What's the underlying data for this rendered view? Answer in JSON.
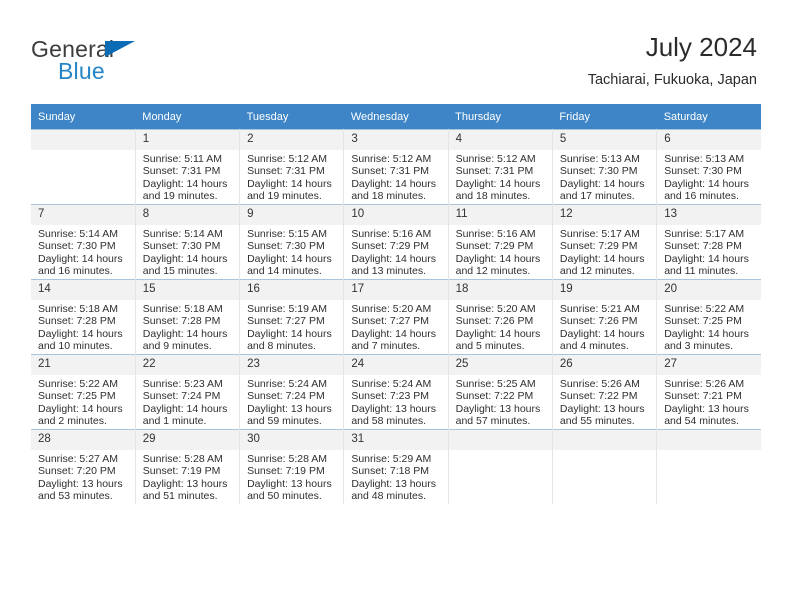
{
  "brand": {
    "name_part1": "General",
    "name_part2": "Blue",
    "triangle_color": "#0b6cb5",
    "blue_color": "#2585c7"
  },
  "header": {
    "title": "July 2024",
    "subtitle": "Tachiarai, Fukuoka, Japan"
  },
  "theme": {
    "header_row_bg": "#3d85c6",
    "header_row_text": "#ffffff",
    "daynum_bg": "#f2f2f2",
    "grid_line": "#a9c4dd"
  },
  "calendar": {
    "weekday_headers": [
      "Sunday",
      "Monday",
      "Tuesday",
      "Wednesday",
      "Thursday",
      "Friday",
      "Saturday"
    ],
    "weeks": [
      [
        {
          "day": "",
          "sunrise": "",
          "sunset": "",
          "daylight": "",
          "empty": true
        },
        {
          "day": "1",
          "sunrise": "Sunrise: 5:11 AM",
          "sunset": "Sunset: 7:31 PM",
          "daylight": "Daylight: 14 hours and 19 minutes."
        },
        {
          "day": "2",
          "sunrise": "Sunrise: 5:12 AM",
          "sunset": "Sunset: 7:31 PM",
          "daylight": "Daylight: 14 hours and 19 minutes."
        },
        {
          "day": "3",
          "sunrise": "Sunrise: 5:12 AM",
          "sunset": "Sunset: 7:31 PM",
          "daylight": "Daylight: 14 hours and 18 minutes."
        },
        {
          "day": "4",
          "sunrise": "Sunrise: 5:12 AM",
          "sunset": "Sunset: 7:31 PM",
          "daylight": "Daylight: 14 hours and 18 minutes."
        },
        {
          "day": "5",
          "sunrise": "Sunrise: 5:13 AM",
          "sunset": "Sunset: 7:30 PM",
          "daylight": "Daylight: 14 hours and 17 minutes."
        },
        {
          "day": "6",
          "sunrise": "Sunrise: 5:13 AM",
          "sunset": "Sunset: 7:30 PM",
          "daylight": "Daylight: 14 hours and 16 minutes."
        }
      ],
      [
        {
          "day": "7",
          "sunrise": "Sunrise: 5:14 AM",
          "sunset": "Sunset: 7:30 PM",
          "daylight": "Daylight: 14 hours and 16 minutes."
        },
        {
          "day": "8",
          "sunrise": "Sunrise: 5:14 AM",
          "sunset": "Sunset: 7:30 PM",
          "daylight": "Daylight: 14 hours and 15 minutes."
        },
        {
          "day": "9",
          "sunrise": "Sunrise: 5:15 AM",
          "sunset": "Sunset: 7:30 PM",
          "daylight": "Daylight: 14 hours and 14 minutes."
        },
        {
          "day": "10",
          "sunrise": "Sunrise: 5:16 AM",
          "sunset": "Sunset: 7:29 PM",
          "daylight": "Daylight: 14 hours and 13 minutes."
        },
        {
          "day": "11",
          "sunrise": "Sunrise: 5:16 AM",
          "sunset": "Sunset: 7:29 PM",
          "daylight": "Daylight: 14 hours and 12 minutes."
        },
        {
          "day": "12",
          "sunrise": "Sunrise: 5:17 AM",
          "sunset": "Sunset: 7:29 PM",
          "daylight": "Daylight: 14 hours and 12 minutes."
        },
        {
          "day": "13",
          "sunrise": "Sunrise: 5:17 AM",
          "sunset": "Sunset: 7:28 PM",
          "daylight": "Daylight: 14 hours and 11 minutes."
        }
      ],
      [
        {
          "day": "14",
          "sunrise": "Sunrise: 5:18 AM",
          "sunset": "Sunset: 7:28 PM",
          "daylight": "Daylight: 14 hours and 10 minutes."
        },
        {
          "day": "15",
          "sunrise": "Sunrise: 5:18 AM",
          "sunset": "Sunset: 7:28 PM",
          "daylight": "Daylight: 14 hours and 9 minutes."
        },
        {
          "day": "16",
          "sunrise": "Sunrise: 5:19 AM",
          "sunset": "Sunset: 7:27 PM",
          "daylight": "Daylight: 14 hours and 8 minutes."
        },
        {
          "day": "17",
          "sunrise": "Sunrise: 5:20 AM",
          "sunset": "Sunset: 7:27 PM",
          "daylight": "Daylight: 14 hours and 7 minutes."
        },
        {
          "day": "18",
          "sunrise": "Sunrise: 5:20 AM",
          "sunset": "Sunset: 7:26 PM",
          "daylight": "Daylight: 14 hours and 5 minutes."
        },
        {
          "day": "19",
          "sunrise": "Sunrise: 5:21 AM",
          "sunset": "Sunset: 7:26 PM",
          "daylight": "Daylight: 14 hours and 4 minutes."
        },
        {
          "day": "20",
          "sunrise": "Sunrise: 5:22 AM",
          "sunset": "Sunset: 7:25 PM",
          "daylight": "Daylight: 14 hours and 3 minutes."
        }
      ],
      [
        {
          "day": "21",
          "sunrise": "Sunrise: 5:22 AM",
          "sunset": "Sunset: 7:25 PM",
          "daylight": "Daylight: 14 hours and 2 minutes."
        },
        {
          "day": "22",
          "sunrise": "Sunrise: 5:23 AM",
          "sunset": "Sunset: 7:24 PM",
          "daylight": "Daylight: 14 hours and 1 minute."
        },
        {
          "day": "23",
          "sunrise": "Sunrise: 5:24 AM",
          "sunset": "Sunset: 7:24 PM",
          "daylight": "Daylight: 13 hours and 59 minutes."
        },
        {
          "day": "24",
          "sunrise": "Sunrise: 5:24 AM",
          "sunset": "Sunset: 7:23 PM",
          "daylight": "Daylight: 13 hours and 58 minutes."
        },
        {
          "day": "25",
          "sunrise": "Sunrise: 5:25 AM",
          "sunset": "Sunset: 7:22 PM",
          "daylight": "Daylight: 13 hours and 57 minutes."
        },
        {
          "day": "26",
          "sunrise": "Sunrise: 5:26 AM",
          "sunset": "Sunset: 7:22 PM",
          "daylight": "Daylight: 13 hours and 55 minutes."
        },
        {
          "day": "27",
          "sunrise": "Sunrise: 5:26 AM",
          "sunset": "Sunset: 7:21 PM",
          "daylight": "Daylight: 13 hours and 54 minutes."
        }
      ],
      [
        {
          "day": "28",
          "sunrise": "Sunrise: 5:27 AM",
          "sunset": "Sunset: 7:20 PM",
          "daylight": "Daylight: 13 hours and 53 minutes."
        },
        {
          "day": "29",
          "sunrise": "Sunrise: 5:28 AM",
          "sunset": "Sunset: 7:19 PM",
          "daylight": "Daylight: 13 hours and 51 minutes."
        },
        {
          "day": "30",
          "sunrise": "Sunrise: 5:28 AM",
          "sunset": "Sunset: 7:19 PM",
          "daylight": "Daylight: 13 hours and 50 minutes."
        },
        {
          "day": "31",
          "sunrise": "Sunrise: 5:29 AM",
          "sunset": "Sunset: 7:18 PM",
          "daylight": "Daylight: 13 hours and 48 minutes."
        },
        {
          "day": "",
          "sunrise": "",
          "sunset": "",
          "daylight": "",
          "empty": true
        },
        {
          "day": "",
          "sunrise": "",
          "sunset": "",
          "daylight": "",
          "empty": true
        },
        {
          "day": "",
          "sunrise": "",
          "sunset": "",
          "daylight": "",
          "empty": true
        }
      ]
    ]
  }
}
